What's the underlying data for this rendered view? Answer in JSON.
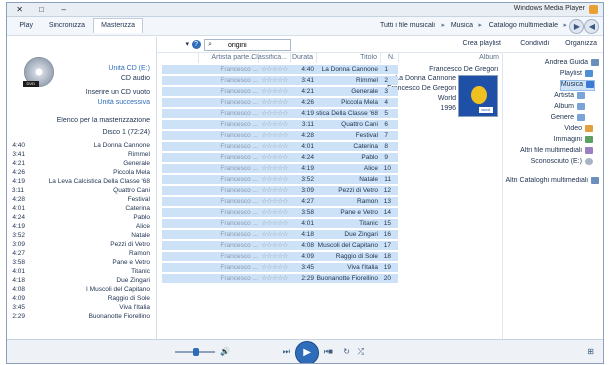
{
  "window": {
    "title": "Windows Media Player",
    "buttons": {
      "minimize": "–",
      "maximize": "□",
      "close": "✕"
    }
  },
  "address": {
    "crumbs": [
      "Catalogo multimediale",
      "Musica",
      "Tutti i file musicali"
    ],
    "separator": "▸"
  },
  "tabs": [
    "Play",
    "Masterizza",
    "Sincronizza"
  ],
  "toolbar": {
    "organize": "Organizza",
    "stream": "Condividi",
    "create_playlist": "Crea playlist",
    "search_placeholder": "Cerca",
    "search_value": "origini",
    "view_options": "▾"
  },
  "nav": {
    "items": [
      {
        "label": "Andrea Guida",
        "icon": "user-icon"
      },
      {
        "label": "Playlist",
        "icon": "playlist-icon"
      },
      {
        "label": "Musica",
        "icon": "music-icon"
      },
      {
        "label": "Artista",
        "icon": "artist-icon"
      },
      {
        "label": "Album",
        "icon": "album-icon"
      },
      {
        "label": "Genere",
        "icon": "genre-icon"
      },
      {
        "label": "Video",
        "icon": "video-icon"
      },
      {
        "label": "Immagini",
        "icon": "picture-icon"
      },
      {
        "label": "Altri file multimediali",
        "icon": "other-media-icon"
      },
      {
        "label": "Sconosciuto (E:)",
        "icon": "disc-icon"
      },
      {
        "label": "Altri Cataloghi multimediali",
        "icon": "network-icon"
      }
    ],
    "selected_index": 2
  },
  "columns": {
    "album": "Album",
    "number": "N.",
    "title": "Titolo",
    "duration": "Durata",
    "rating": "Classifica...",
    "artist": "Artista parte..."
  },
  "album": {
    "artist": "Francesco De Gregori",
    "title": "La Donna Cannone",
    "performer": "Francesco De Gregori",
    "genre": "World",
    "year": "1996",
    "cover_badge": "word"
  },
  "tracks": [
    {
      "n": "1",
      "title": "La Donna Cannone",
      "duration": "4:40",
      "rating": "☆☆☆☆☆",
      "artist": "Francesco ..."
    },
    {
      "n": "2",
      "title": "Rimmel",
      "duration": "3:41",
      "rating": "☆☆☆☆☆",
      "artist": "Francesco ..."
    },
    {
      "n": "3",
      "title": "Generale",
      "duration": "4:21",
      "rating": "☆☆☆☆☆",
      "artist": "Francesco ..."
    },
    {
      "n": "4",
      "title": "Piccola Mela",
      "duration": "4:26",
      "rating": "☆☆☆☆☆",
      "artist": "Francesco ..."
    },
    {
      "n": "5",
      "title": "La Leva Calcistica Della Classe '68",
      "duration": "4:19",
      "rating": "☆☆☆☆☆",
      "artist": "Francesco ..."
    },
    {
      "n": "6",
      "title": "Quattro Cani",
      "duration": "3:11",
      "rating": "☆☆☆☆☆",
      "artist": "Francesco ..."
    },
    {
      "n": "7",
      "title": "Festival",
      "duration": "4:28",
      "rating": "☆☆☆☆☆",
      "artist": "Francesco ..."
    },
    {
      "n": "8",
      "title": "Caterina",
      "duration": "4:01",
      "rating": "☆☆☆☆☆",
      "artist": "Francesco ..."
    },
    {
      "n": "9",
      "title": "Pablo",
      "duration": "4:24",
      "rating": "☆☆☆☆☆",
      "artist": "Francesco ..."
    },
    {
      "n": "10",
      "title": "Alice",
      "duration": "4:19",
      "rating": "☆☆☆☆☆",
      "artist": "Francesco ..."
    },
    {
      "n": "11",
      "title": "Natale",
      "duration": "3:52",
      "rating": "☆☆☆☆☆",
      "artist": "Francesco ..."
    },
    {
      "n": "12",
      "title": "Pezzi di Vetro",
      "duration": "3:09",
      "rating": "☆☆☆☆☆",
      "artist": "Francesco ..."
    },
    {
      "n": "13",
      "title": "Ramon",
      "duration": "4:27",
      "rating": "☆☆☆☆☆",
      "artist": "Francesco ..."
    },
    {
      "n": "14",
      "title": "Pane e Vetro",
      "duration": "3:58",
      "rating": "☆☆☆☆☆",
      "artist": "Francesco ..."
    },
    {
      "n": "15",
      "title": "Titanic",
      "duration": "4:01",
      "rating": "☆☆☆☆☆",
      "artist": "Francesco ..."
    },
    {
      "n": "16",
      "title": "Due Zingari",
      "duration": "4:18",
      "rating": "☆☆☆☆☆",
      "artist": "Francesco ..."
    },
    {
      "n": "17",
      "title": "I Muscoli del Capitano",
      "duration": "4:08",
      "rating": "☆☆☆☆☆",
      "artist": "Francesco ..."
    },
    {
      "n": "18",
      "title": "Raggio di Sole",
      "duration": "4:09",
      "rating": "☆☆☆☆☆",
      "artist": "Francesco ..."
    },
    {
      "n": "19",
      "title": "Viva l'Italia",
      "duration": "3:45",
      "rating": "☆☆☆☆☆",
      "artist": "Francesco ..."
    },
    {
      "n": "20",
      "title": "Buonanotte Fiorellino",
      "duration": "2:29",
      "rating": "☆☆☆☆☆",
      "artist": "Francesco ..."
    }
  ],
  "listpane": {
    "drive": "Unità CD (E:)",
    "drive_type": "CD audio",
    "insert_prompt": "Inserire un CD vuoto",
    "next_drive": "Unità successiva",
    "disc_badge": "DVD",
    "drop_hint": "Elenco per la masterizzazione",
    "disc_label": "Disco 1 (72:24)",
    "items": [
      {
        "title": "La Donna Cannone",
        "duration": "4:40"
      },
      {
        "title": "Rimmel",
        "duration": "3:41"
      },
      {
        "title": "Generale",
        "duration": "4:21"
      },
      {
        "title": "Piccola Mela",
        "duration": "4:26"
      },
      {
        "title": "La Leva Calcistica Della Classe '68",
        "duration": "4:19"
      },
      {
        "title": "Quattro Cani",
        "duration": "3:11"
      },
      {
        "title": "Festival",
        "duration": "4:28"
      },
      {
        "title": "Caterina",
        "duration": "4:01"
      },
      {
        "title": "Pablo",
        "duration": "4:24"
      },
      {
        "title": "Alice",
        "duration": "4:19"
      },
      {
        "title": "Natale",
        "duration": "3:52"
      },
      {
        "title": "Pezzi di Vetro",
        "duration": "3:09"
      },
      {
        "title": "Ramon",
        "duration": "4:27"
      },
      {
        "title": "Pane e Vetro",
        "duration": "3:58"
      },
      {
        "title": "Titanic",
        "duration": "4:01"
      },
      {
        "title": "Due Zingari",
        "duration": "4:18"
      },
      {
        "title": "I Muscoli del Capitano",
        "duration": "4:08"
      },
      {
        "title": "Raggio di Sole",
        "duration": "4:09"
      },
      {
        "title": "Viva l'Italia",
        "duration": "3:45"
      },
      {
        "title": "Buonanotte Fiorellino",
        "duration": "2:29"
      }
    ]
  },
  "player": {
    "shuffle": "⤮",
    "repeat": "↻",
    "stop": "■",
    "prev": "⏮",
    "play": "▶",
    "next": "⏭",
    "mute": "🔊",
    "switch_view": "⊞"
  },
  "colors": {
    "accent": "#2f6dba",
    "selection": "#cde2f7",
    "frame": "#8aa0bb"
  }
}
